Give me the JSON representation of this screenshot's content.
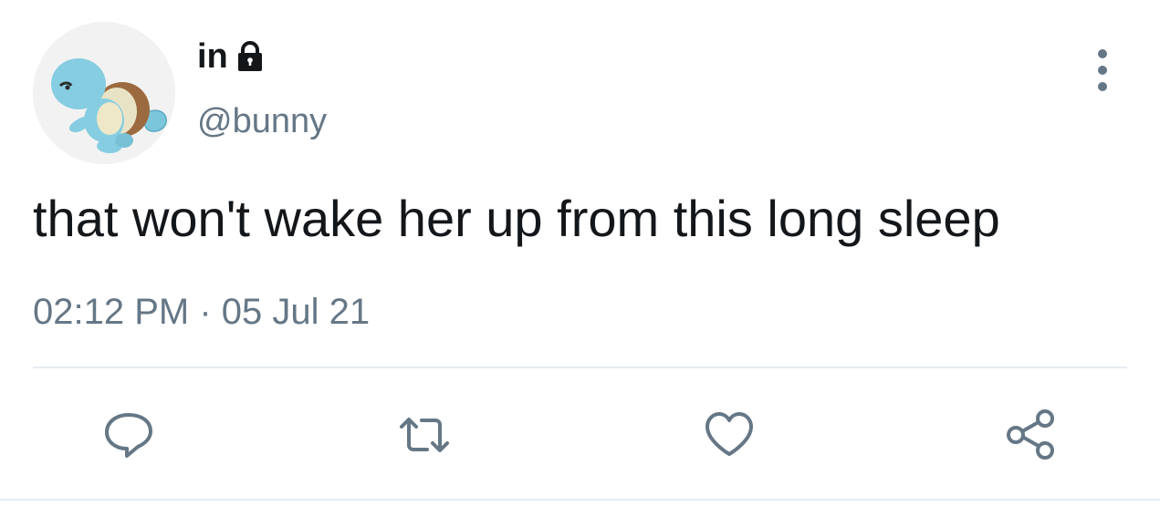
{
  "author": {
    "display_name": "in",
    "handle": "@bunny",
    "protected_icon": "lock-icon",
    "avatar_icon": "squirtle-avatar"
  },
  "tweet": {
    "text": "that won't wake her up from this long sleep",
    "time": "02:12 PM",
    "separator": "·",
    "date": "05 Jul 21"
  },
  "actions": {
    "reply_icon": "reply-icon",
    "retweet_icon": "retweet-icon",
    "like_icon": "heart-icon",
    "share_icon": "share-icon",
    "more_icon": "more-vertical-icon"
  },
  "colors": {
    "text": "#14171a",
    "secondary": "#657786",
    "divider": "#e6ecf0",
    "icon": "#657786"
  }
}
